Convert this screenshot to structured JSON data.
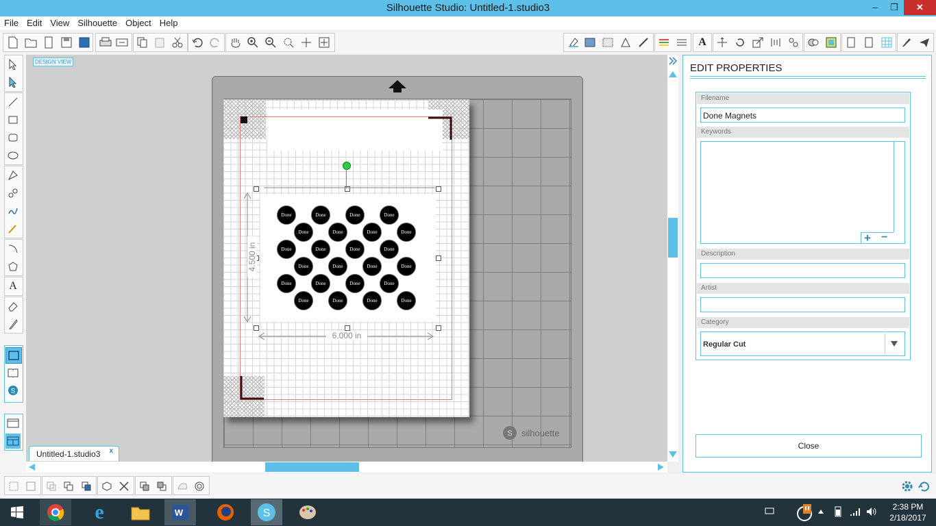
{
  "window": {
    "title": "Silhouette Studio: Untitled-1.studio3",
    "minimize": "‒",
    "restore": "❐",
    "close": "✕"
  },
  "menu": [
    "File",
    "Edit",
    "View",
    "Silhouette",
    "Object",
    "Help"
  ],
  "canvas": {
    "design_view_badge": "DESIGN VIEW",
    "width_label": "6.000 in",
    "height_label": "4.500 in",
    "watermark": "silhouette",
    "artwork_text": "Done"
  },
  "document_tab": {
    "label": "Untitled-1.studio3",
    "close": "x"
  },
  "panel": {
    "title": "EDIT PROPERTIES",
    "filename_label": "Filename",
    "filename_value": "Done Magnets",
    "keywords_label": "Keywords",
    "keywords_value": "",
    "description_label": "Description",
    "description_value": "",
    "artist_label": "Artist",
    "artist_value": "",
    "category_label": "Category",
    "category_value": "Regular Cut",
    "add_symbol": "+",
    "remove_symbol": "−",
    "close_button": "Close"
  },
  "taskbar": {
    "time": "2:38 PM",
    "date": "2/18/2017"
  },
  "colors": {
    "accent": "#5cc0e8",
    "close_red": "#c9302c",
    "taskbar": "#23333c"
  }
}
